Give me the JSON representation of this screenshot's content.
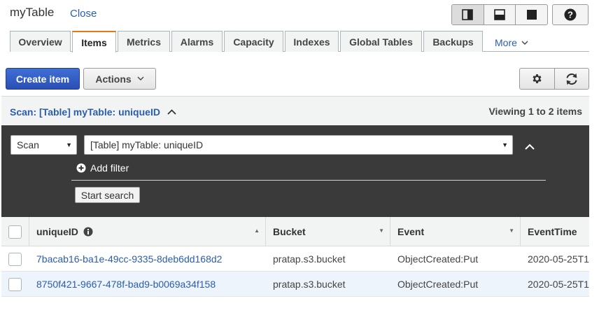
{
  "header": {
    "title": "myTable",
    "close_label": "Close"
  },
  "view_controls": [
    "split-vertical",
    "split-horizontal",
    "fullscreen"
  ],
  "tabs": [
    {
      "label": "Overview"
    },
    {
      "label": "Items",
      "active": true
    },
    {
      "label": "Metrics"
    },
    {
      "label": "Alarms"
    },
    {
      "label": "Capacity"
    },
    {
      "label": "Indexes"
    },
    {
      "label": "Global Tables"
    },
    {
      "label": "Backups"
    }
  ],
  "more_label": "More",
  "toolbar": {
    "create_label": "Create item",
    "actions_label": "Actions"
  },
  "scan_header": {
    "title": "Scan: [Table] myTable: uniqueID",
    "viewing": "Viewing 1 to 2 items"
  },
  "scan_panel": {
    "mode": "Scan",
    "target": "[Table] myTable: uniqueID",
    "add_filter": "Add filter",
    "start_search": "Start search"
  },
  "table": {
    "columns": [
      "uniqueID",
      "Bucket",
      "Event",
      "EventTime"
    ],
    "rows": [
      {
        "uniqueID": "7bacab16-ba1e-49cc-9335-8deb6dd168d2",
        "Bucket": "pratap.s3.bucket",
        "Event": "ObjectCreated:Put",
        "EventTime": "2020-05-25T1"
      },
      {
        "uniqueID": "8750f421-9667-478f-bad9-b0069a34f158",
        "Bucket": "pratap.s3.bucket",
        "Event": "ObjectCreated:Put",
        "EventTime": "2020-05-25T1"
      }
    ]
  },
  "colors": {
    "accent_blue": "#2a5db0",
    "primary_button": "#2a4fb4",
    "active_tab_top": "#e47911",
    "panel_dark": "#3a3a3a"
  }
}
